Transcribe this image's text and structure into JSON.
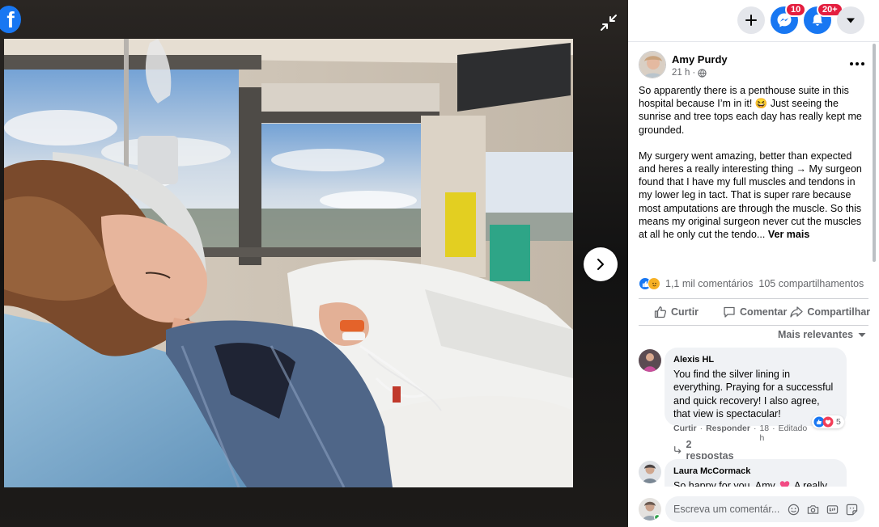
{
  "colors": {
    "brand": "#1877f2",
    "badge": "#e41e3f",
    "text_secondary": "#65676b",
    "bubble": "#f0f2f5"
  },
  "viewer": {
    "logo": "f"
  },
  "topbar": {
    "messenger_badge": "10",
    "notifications_badge": "20+"
  },
  "post": {
    "author": "Amy Purdy",
    "time": "21 h",
    "paragraph1": "So apparently there is a penthouse suite in this hospital because I’m in it! 😆 Just seeing the sunrise and tree tops each day has really kept me grounded.",
    "paragraph2": "My surgery went amazing, better than expected and heres a really interesting thing → My surgeon found that I have my full muscles and tendons in my lower leg in tact. That is super rare because most amputations are through the muscle. So this means my original surgeon never cut the muscles at all he only cut the tendo...",
    "see_more": "Ver mais",
    "comments_count": "1,1 mil comentários",
    "shares_count": "105 compartilhamentos"
  },
  "actions": {
    "like": "Curtir",
    "comment": "Comentar",
    "share": "Compartilhar"
  },
  "sort_label": "Mais relevantes",
  "comments": [
    {
      "name": "Alexis HL",
      "text": "You find the silver lining in everything. Praying for a successful and quick recovery! I also agree, that view is spectacular!",
      "like": "Curtir",
      "reply": "Responder",
      "time": "18 h",
      "edited": "Editado",
      "reactions": "5",
      "replies": "2 respostas"
    },
    {
      "name": "Laura McCormack",
      "text_start": "So happy for you, Amy",
      "text_end": "A really"
    }
  ],
  "compose": {
    "placeholder": "Escreva um comentár..."
  }
}
